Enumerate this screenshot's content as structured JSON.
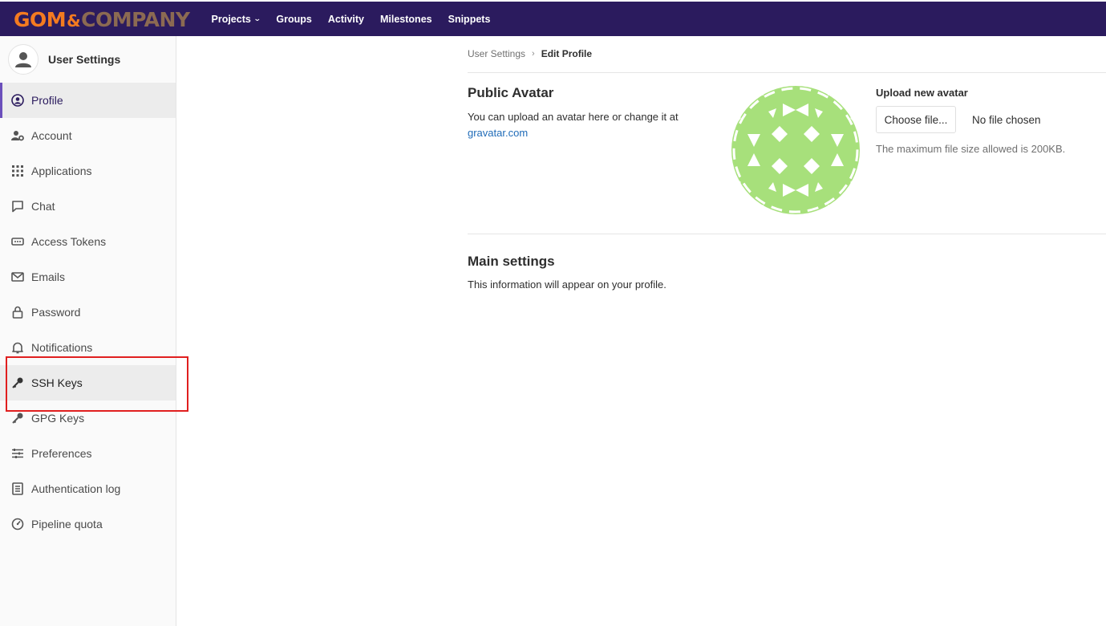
{
  "brand": {
    "part1": "GOM",
    "amp": "&",
    "part2": "COMPANY",
    "primary_color": "#2b1b5e",
    "accent": "#f47b20"
  },
  "topnav": {
    "items": [
      {
        "label": "Projects",
        "has_dropdown": true
      },
      {
        "label": "Groups"
      },
      {
        "label": "Activity"
      },
      {
        "label": "Milestones"
      },
      {
        "label": "Snippets"
      }
    ]
  },
  "sidebar": {
    "title": "User Settings",
    "items": [
      {
        "label": "Profile",
        "icon": "profile-icon",
        "active": true
      },
      {
        "label": "Account",
        "icon": "account-icon"
      },
      {
        "label": "Applications",
        "icon": "applications-icon"
      },
      {
        "label": "Chat",
        "icon": "chat-icon"
      },
      {
        "label": "Access Tokens",
        "icon": "token-icon"
      },
      {
        "label": "Emails",
        "icon": "mail-icon"
      },
      {
        "label": "Password",
        "icon": "lock-icon"
      },
      {
        "label": "Notifications",
        "icon": "bell-icon"
      },
      {
        "label": "SSH Keys",
        "icon": "key-icon",
        "highlighted": true
      },
      {
        "label": "GPG Keys",
        "icon": "key-icon"
      },
      {
        "label": "Preferences",
        "icon": "preferences-icon"
      },
      {
        "label": "Authentication log",
        "icon": "log-icon"
      },
      {
        "label": "Pipeline quota",
        "icon": "quota-icon"
      }
    ]
  },
  "breadcrumb": {
    "parent": "User Settings",
    "current": "Edit Profile"
  },
  "avatar_section": {
    "title": "Public Avatar",
    "description": "You can upload an avatar here or change it at",
    "link_text": "gravatar.com",
    "avatar_color": "#a7e07b",
    "upload_label": "Upload new avatar",
    "choose_button": "Choose file...",
    "no_file": "No file chosen",
    "help": "The maximum file size allowed is 200KB."
  },
  "main_settings": {
    "title": "Main settings",
    "description": "This information will appear on your profile."
  }
}
